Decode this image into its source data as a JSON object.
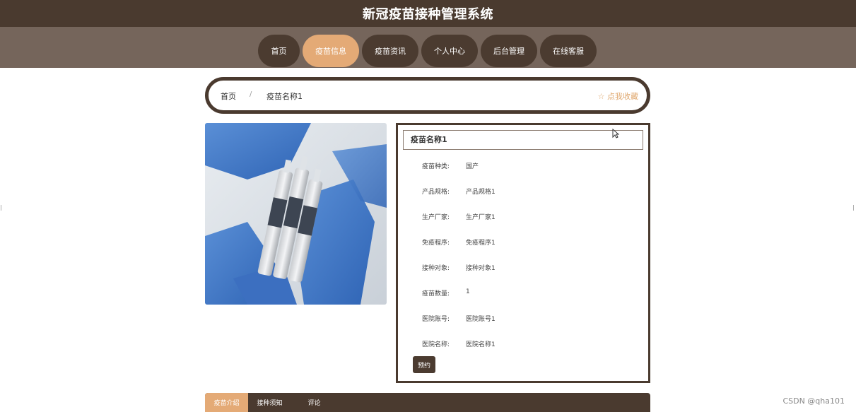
{
  "header": {
    "title": "新冠疫苗接种管理系统"
  },
  "nav": {
    "items": [
      {
        "label": "首页"
      },
      {
        "label": "疫苗信息",
        "active": true
      },
      {
        "label": "疫苗资讯"
      },
      {
        "label": "个人中心"
      },
      {
        "label": "后台管理"
      },
      {
        "label": "在线客服"
      }
    ]
  },
  "breadcrumb": {
    "home": "首页",
    "separator": "/",
    "current": "疫苗名称1",
    "favorite": "☆ 点我收藏"
  },
  "detail": {
    "title": "疫苗名称1",
    "fields": [
      {
        "label": "疫苗种类:",
        "value": "国产"
      },
      {
        "label": "产品规格:",
        "value": "产品规格1"
      },
      {
        "label": "生产厂家:",
        "value": "生产厂家1"
      },
      {
        "label": "免疫程序:",
        "value": "免疫程序1"
      },
      {
        "label": "接种对象:",
        "value": "接种对象1"
      },
      {
        "label": "疫苗数量:",
        "value": "1"
      },
      {
        "label": "医院账号:",
        "value": "医院账号1"
      },
      {
        "label": "医院名称:",
        "value": "医院名称1"
      }
    ],
    "book_label": "预约"
  },
  "tabs": [
    {
      "label": "疫苗介绍",
      "active": true
    },
    {
      "label": "接种须知"
    },
    {
      "label": "评论"
    }
  ],
  "watermark": "CSDN @qha101",
  "colors": {
    "primary": "#4a3a2f",
    "accent": "#e4aa76",
    "nav_band": "#75655b"
  }
}
